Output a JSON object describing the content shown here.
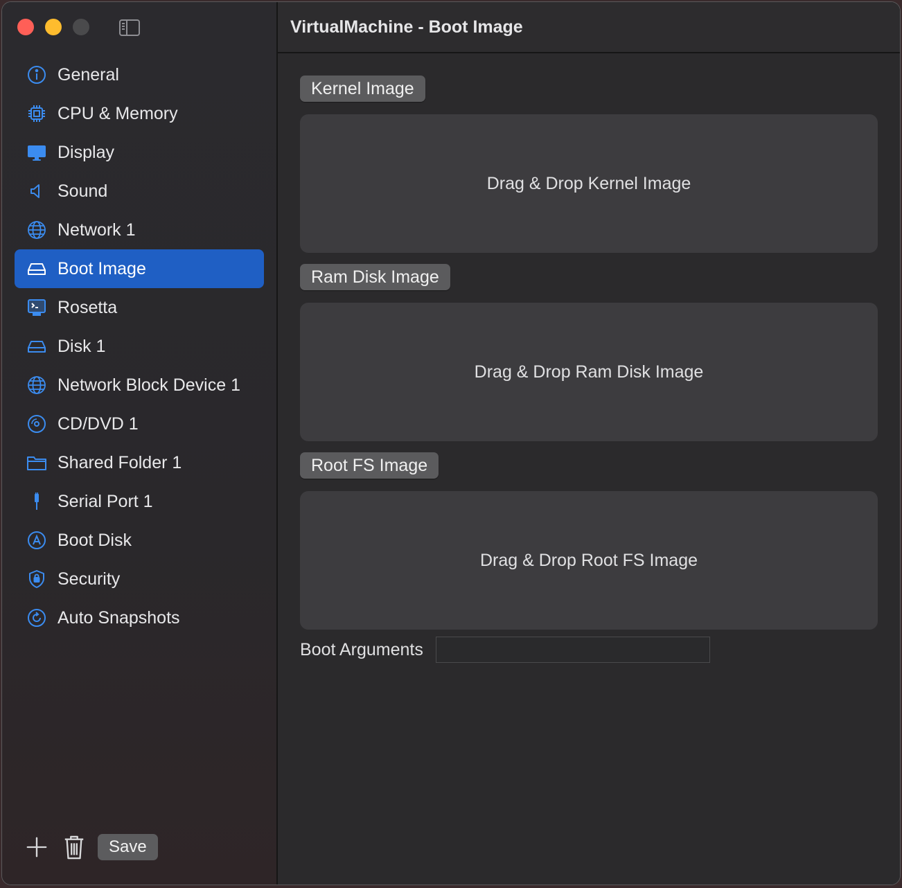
{
  "window": {
    "title": "VirtualMachine - Boot Image"
  },
  "sidebar": {
    "items": [
      {
        "label": "General",
        "icon": "info-icon",
        "active": false
      },
      {
        "label": "CPU & Memory",
        "icon": "cpu-icon",
        "active": false
      },
      {
        "label": "Display",
        "icon": "display-icon",
        "active": false
      },
      {
        "label": "Sound",
        "icon": "speaker-icon",
        "active": false
      },
      {
        "label": "Network 1",
        "icon": "globe-icon",
        "active": false
      },
      {
        "label": "Boot Image",
        "icon": "drive-icon",
        "active": true
      },
      {
        "label": "Rosetta",
        "icon": "terminal-display-icon",
        "active": false
      },
      {
        "label": "Disk 1",
        "icon": "drive-icon",
        "active": false
      },
      {
        "label": "Network Block Device 1",
        "icon": "globe-icon",
        "active": false
      },
      {
        "label": "CD/DVD 1",
        "icon": "disc-icon",
        "active": false
      },
      {
        "label": "Shared Folder 1",
        "icon": "folder-icon",
        "active": false
      },
      {
        "label": "Serial Port 1",
        "icon": "cable-icon",
        "active": false
      },
      {
        "label": "Boot Disk",
        "icon": "boot-disk-icon",
        "active": false
      },
      {
        "label": "Security",
        "icon": "shield-icon",
        "active": false
      },
      {
        "label": "Auto Snapshots",
        "icon": "snapshot-icon",
        "active": false
      }
    ],
    "footer": {
      "add_icon": "plus-icon",
      "delete_icon": "trash-icon",
      "save_label": "Save"
    }
  },
  "main": {
    "sections": [
      {
        "button_label": "Kernel Image",
        "drop_text": "Drag & Drop Kernel Image"
      },
      {
        "button_label": "Ram Disk Image",
        "drop_text": "Drag & Drop Ram Disk Image"
      },
      {
        "button_label": "Root FS Image",
        "drop_text": "Drag & Drop Root FS Image"
      }
    ],
    "boot_arguments": {
      "label": "Boot Arguments",
      "value": ""
    }
  },
  "colors": {
    "accent": "#1f5fc4",
    "icon_blue": "#3b8cf0",
    "traffic_close": "#ff5f57",
    "traffic_min": "#febc2e"
  }
}
